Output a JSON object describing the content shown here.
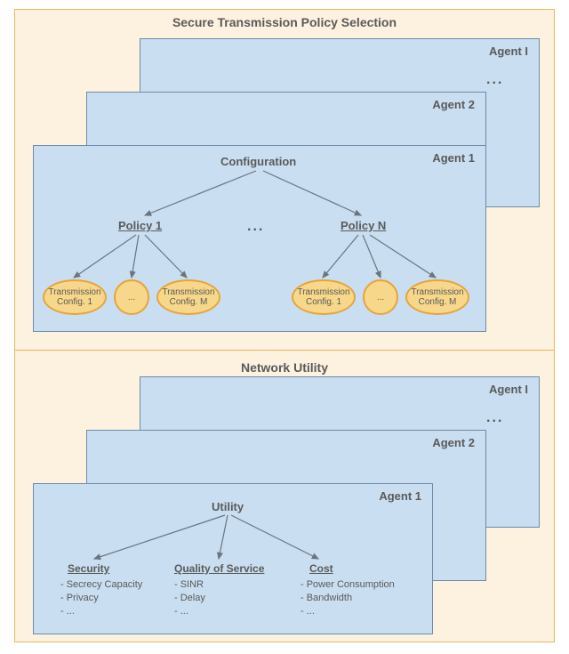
{
  "top": {
    "title": "Secure Transmission Policy Selection",
    "agents": [
      "Agent I",
      "Agent 2",
      "Agent 1"
    ],
    "stack_ellipsis": "...",
    "root": "Configuration",
    "policies": {
      "left": "Policy 1",
      "right": "Policy N",
      "mid": "..."
    },
    "tx": {
      "l1": "Transmission Config. 1",
      "l2": "...",
      "l3": "Transmission Config. M",
      "r1": "Transmission Config. 1",
      "r2": "...",
      "r3": "Transmission Config. M"
    }
  },
  "bottom": {
    "title": "Network Utility",
    "agents": [
      "Agent I",
      "Agent 2",
      "Agent 1"
    ],
    "stack_ellipsis": "...",
    "root": "Utility",
    "cols": {
      "security": {
        "head": "Security",
        "items": [
          "- Secrecy Capacity",
          "- Privacy",
          "- ..."
        ]
      },
      "qos": {
        "head": "Quality of Service",
        "items": [
          "- SINR",
          "- Delay",
          "- ..."
        ]
      },
      "cost": {
        "head": "Cost",
        "items": [
          "- Power Consumption",
          "- Bandwidth",
          "- ..."
        ]
      }
    }
  }
}
